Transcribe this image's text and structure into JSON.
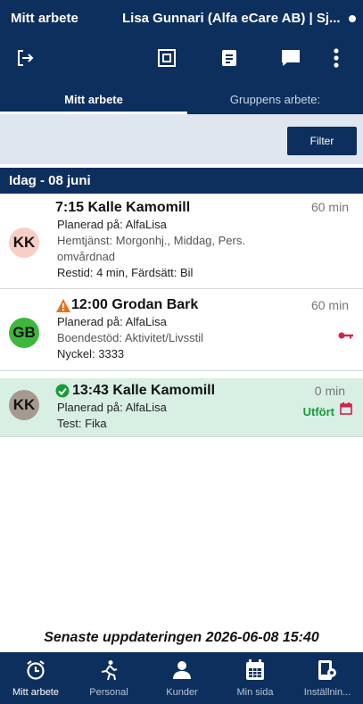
{
  "header": {
    "app_title": "Mitt arbete",
    "user_title": "Lisa Gunnari (Alfa eCare AB) | Sj..."
  },
  "toolbar": {
    "icons": [
      "logout-icon",
      "qr-scan-icon",
      "notes-icon",
      "chat-icon",
      "more-vertical-icon"
    ]
  },
  "tabs": [
    {
      "label": "Mitt arbete",
      "active": true
    },
    {
      "label": "Gruppens arbete:",
      "active": false
    }
  ],
  "filter": {
    "label": "Filter"
  },
  "day_header": "Idag - 08 juni",
  "visits": [
    {
      "initials": "KK",
      "avatar_color": "#f8cfc4",
      "title": "7:15 Kalle Kamomill",
      "duration": "60 min",
      "planned": "Planerad på: AlfaLisa",
      "service_line1": "Hemtjänst: Morgonhj., Middag, Pers.",
      "service_line2": "omvårdnad",
      "travel": "Restid: 4 min, Färdsätt: Bil"
    },
    {
      "initials": "GB",
      "avatar_color": "#3db83a",
      "title": "12:00 Grodan Bark",
      "duration": "60 min",
      "planned": "Planerad på: AlfaLisa",
      "service": "Boendestöd: Aktivitet/Livsstil",
      "key": "Nyckel: 3333",
      "icons": [
        "warning-icon",
        "key-icon"
      ]
    },
    {
      "initials": "KK",
      "avatar_color": "#a59a8f",
      "title": "13:43 Kalle Kamomill",
      "duration": "0 min",
      "planned": "Planerad på: AlfaLisa",
      "note": "Test: Fika",
      "status": "Utfört",
      "icons": [
        "check-circle-icon",
        "calendar-icon"
      ]
    }
  ],
  "last_updated": "Senaste uppdateringen 2026-06-08 15:40",
  "bottom_nav": [
    {
      "label": "Mitt arbete",
      "icon": "alarm-clock-icon",
      "active": true
    },
    {
      "label": "Personal",
      "icon": "running-person-icon",
      "active": false
    },
    {
      "label": "Kunder",
      "icon": "person-icon",
      "active": false
    },
    {
      "label": "Min sida",
      "icon": "calendar-grid-icon",
      "active": false
    },
    {
      "label": "Inställnin...",
      "icon": "settings-phone-icon",
      "active": false
    }
  ],
  "colors": {
    "navy": "#0d2f5e",
    "filter_bar": "#dfe6f0",
    "done_bg": "#d8efe4",
    "warning": "#e8721c",
    "key": "#d6214c",
    "success": "#1b9a3a"
  }
}
